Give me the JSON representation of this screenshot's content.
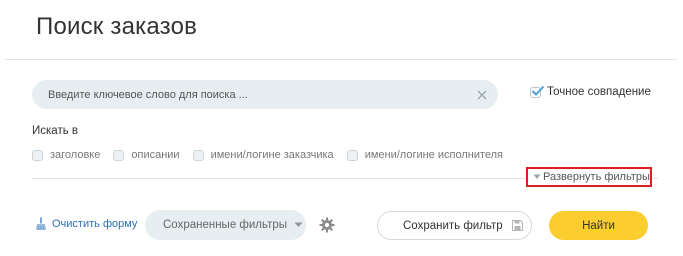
{
  "page": {
    "title": "Поиск заказов"
  },
  "search": {
    "placeholder": "Введите ключевое слово для поиска ...",
    "value": "",
    "exact_match": {
      "label": "Точное совпадение",
      "checked": true
    }
  },
  "search_in": {
    "label": "Искать в",
    "options": [
      {
        "label": "заголовке",
        "checked": false
      },
      {
        "label": "описании",
        "checked": false
      },
      {
        "label": "имени/логине заказчика",
        "checked": false
      },
      {
        "label": "имени/логине исполнителя",
        "checked": false
      }
    ]
  },
  "filters": {
    "expand_label": "Развернуть фильтры"
  },
  "footer": {
    "clear_form_label": "Очистить форму",
    "saved_filters_label": "Сохраненные фильтры",
    "save_filter_label": "Сохранить фильтр",
    "find_label": "Найти"
  },
  "icons": {
    "clear": "close-icon",
    "exact_check": "check-icon",
    "expand": "chevron-down-icon",
    "clear_form": "broom-icon",
    "saved_filters": "caret-down-icon",
    "settings": "gear-icon",
    "save": "floppy-disk-icon"
  },
  "colors": {
    "accent_yellow": "#fccd2e",
    "link_blue": "#2a6fb8",
    "highlight_red": "#d81f26",
    "field_bg": "#e7eef2"
  }
}
